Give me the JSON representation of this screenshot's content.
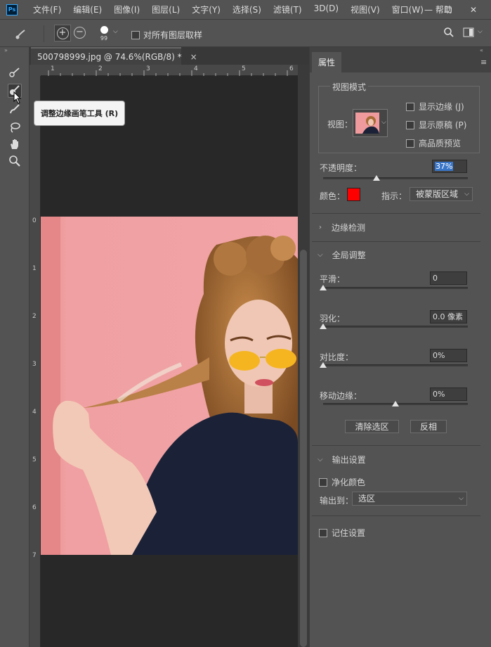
{
  "menubar": {
    "items": [
      "文件(F)",
      "编辑(E)",
      "图像(I)",
      "图层(L)",
      "文字(Y)",
      "选择(S)",
      "滤镜(T)",
      "3D(D)",
      "视图(V)",
      "窗口(W)",
      "帮助"
    ],
    "logo": "Ps"
  },
  "options": {
    "brush_size": "99",
    "sample_all_layers": "对所有图层取样"
  },
  "document": {
    "tab_title": "500798999.jpg @ 74.6%(RGB/8) *",
    "close": "×",
    "hruler": [
      "1",
      "2",
      "3",
      "4",
      "5",
      "6"
    ],
    "vruler": [
      "0",
      "1",
      "2",
      "3",
      "4",
      "5",
      "6",
      "7"
    ]
  },
  "tooltip": {
    "text": "调整边缘画笔工具 (R)"
  },
  "panel": {
    "tab": "属性",
    "view_mode": {
      "title": "视图模式",
      "view_label": "视图：",
      "show_edge": "显示边缘 (J)",
      "show_original": "显示原稿 (P)",
      "hq_preview": "高品质预览"
    },
    "opacity_label": "不透明度：",
    "opacity_value": "37%",
    "opacity_level": 0.37,
    "color_label": "颜色：",
    "color_swatch": "#ff0000",
    "indicate_label": "指示：",
    "indicate_value": "被蒙版区域",
    "edge_detection": "边缘检测",
    "global_refine": "全局调整",
    "smooth_label": "平滑：",
    "smooth_value": "0",
    "feather_label": "羽化：",
    "feather_value": "0.0 像素",
    "contrast_label": "对比度：",
    "contrast_value": "0%",
    "shift_edge_label": "移动边缘：",
    "shift_edge_value": "0%",
    "clear_selection": "清除选区",
    "invert": "反相",
    "output_settings": "输出设置",
    "decontaminate": "净化颜色",
    "output_to_label": "输出到：",
    "output_to_value": "选区",
    "remember": "记住设置"
  }
}
